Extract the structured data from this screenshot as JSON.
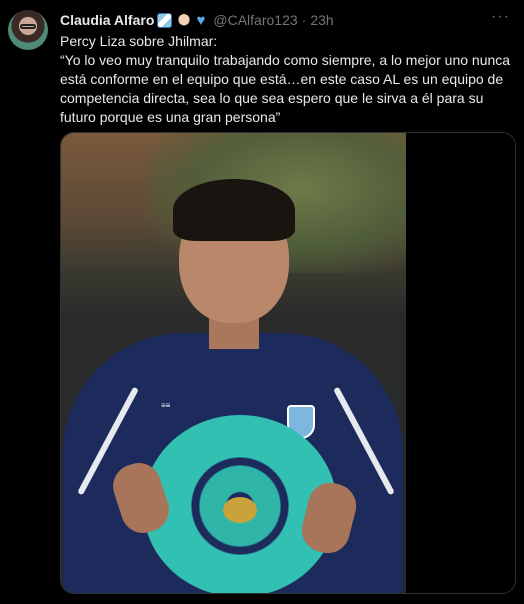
{
  "tweet": {
    "author_name": "Claudia Alfaro",
    "handle": "@CAlfaro123",
    "separator": "·",
    "time": "23h",
    "more_label": "···",
    "emoji_icons": [
      "argentina-flag-icon",
      "flexed-biceps-icon",
      "blue-heart-icon"
    ],
    "text_line1": "Percy Liza sobre Jhilmar:",
    "text_quote": "“Yo lo veo muy tranquilo trabajando como siempre, a lo mejor uno nunca está conforme en el equipo que está…en este caso AL es un equipo de competencia directa, sea lo que sea espero que le sirva a él para su futuro porque es una gran persona”"
  },
  "colors": {
    "background": "#000000",
    "text_primary": "#e7e9ea",
    "text_secondary": "#71767b",
    "border": "#2f3336"
  }
}
